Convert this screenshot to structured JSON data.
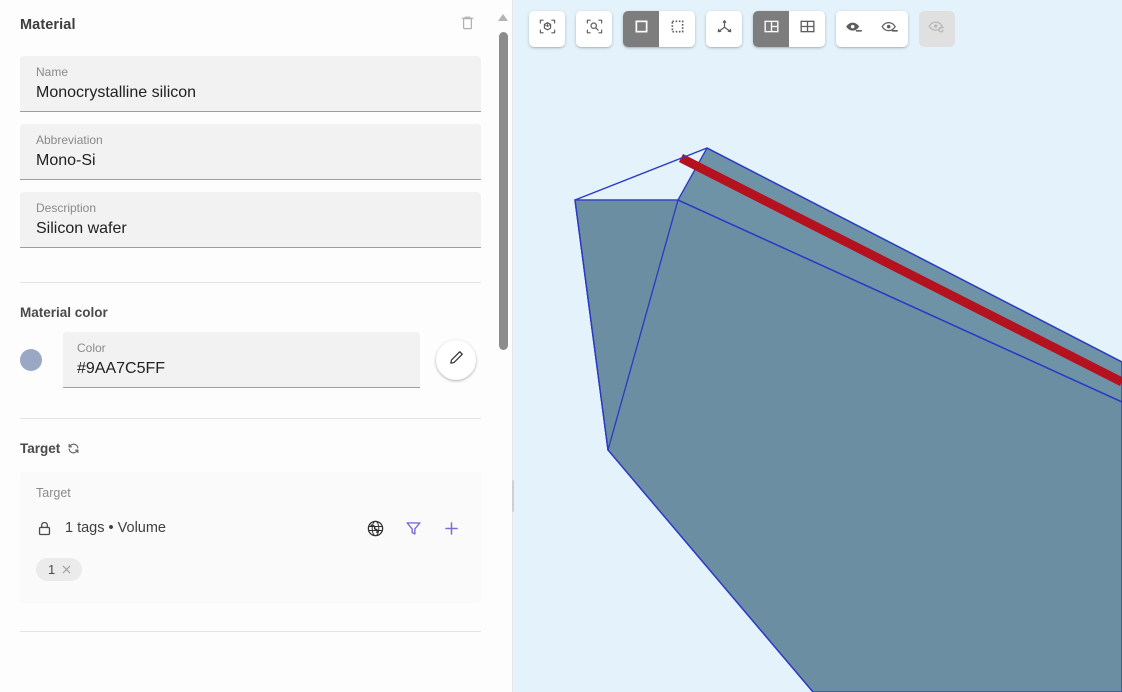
{
  "panel": {
    "title": "Material",
    "delete_icon": "trash-icon",
    "fields": [
      {
        "label": "Name",
        "value": "Monocrystalline silicon"
      },
      {
        "label": "Abbreviation",
        "value": "Mono-Si"
      },
      {
        "label": "Description",
        "value": "Silicon wafer"
      }
    ],
    "color_section": {
      "title": "Material color",
      "field_label": "Color",
      "field_value": "#9AA7C5FF",
      "swatch_color": "#9AA7C5",
      "edit_icon": "pencil-icon"
    },
    "target_section": {
      "title": "Target",
      "refresh_icon": "refresh-icon",
      "card_label": "Target",
      "summary": "1 tags • Volume",
      "lock_icon": "lock-icon",
      "globe_icon": "globe-icon",
      "filter_icon": "filter-icon",
      "add_icon": "plus-icon",
      "accent_color": "#7b6fd4",
      "chips": [
        {
          "label": "1",
          "remove_icon": "close-icon"
        }
      ]
    },
    "scrollbar": {
      "up_arrow_icon": "scroll-up-arrow-icon",
      "thumb_name": "vertical-scroll-thumb"
    },
    "splitter_name": "panel-splitter"
  },
  "viewport": {
    "background_color": "#E3F2FB",
    "object": {
      "face_color": "#6B8EA3",
      "face_color_dark": "#5E8296",
      "edge_color": "#2A3AC4",
      "highlight_color": "#B4121E"
    },
    "toolbar": {
      "groups": [
        {
          "name": "fit-group",
          "buttons": [
            {
              "name": "fit-to-view-button",
              "icon": "cube-fit-icon",
              "state": "normal",
              "tooltip": "Fit to view"
            }
          ]
        },
        {
          "name": "zoom-group",
          "buttons": [
            {
              "name": "zoom-to-selection-button",
              "icon": "magnifier-fit-icon",
              "state": "normal",
              "tooltip": "Zoom to selection"
            }
          ]
        },
        {
          "name": "selection-mode-group",
          "buttons": [
            {
              "name": "select-solid-button",
              "icon": "solid-square-icon",
              "state": "active",
              "tooltip": "Solid selection"
            },
            {
              "name": "select-dashed-button",
              "icon": "dashed-square-icon",
              "state": "normal",
              "tooltip": "Box selection"
            }
          ]
        },
        {
          "name": "axes-group",
          "buttons": [
            {
              "name": "show-axes-button",
              "icon": "axis-gizmo-icon",
              "state": "normal",
              "tooltip": "Show axes"
            }
          ]
        },
        {
          "name": "layout-group",
          "buttons": [
            {
              "name": "layout-split-button",
              "icon": "layout-split-icon",
              "state": "active",
              "tooltip": "Split layout"
            },
            {
              "name": "layout-grid-button",
              "icon": "layout-grid-icon",
              "state": "normal",
              "tooltip": "Grid layout"
            }
          ]
        },
        {
          "name": "visibility-group",
          "buttons": [
            {
              "name": "hide-selected-button",
              "icon": "eye-minus-filled-icon",
              "state": "normal",
              "tooltip": "Hide selected"
            },
            {
              "name": "show-selected-button",
              "icon": "eye-minus-outline-icon",
              "state": "normal",
              "tooltip": "Show selected"
            }
          ]
        },
        {
          "name": "reset-visibility-group",
          "buttons": [
            {
              "name": "reset-visibility-button",
              "icon": "eye-refresh-icon",
              "state": "disabled",
              "tooltip": "Reset visibility"
            }
          ]
        }
      ]
    }
  }
}
